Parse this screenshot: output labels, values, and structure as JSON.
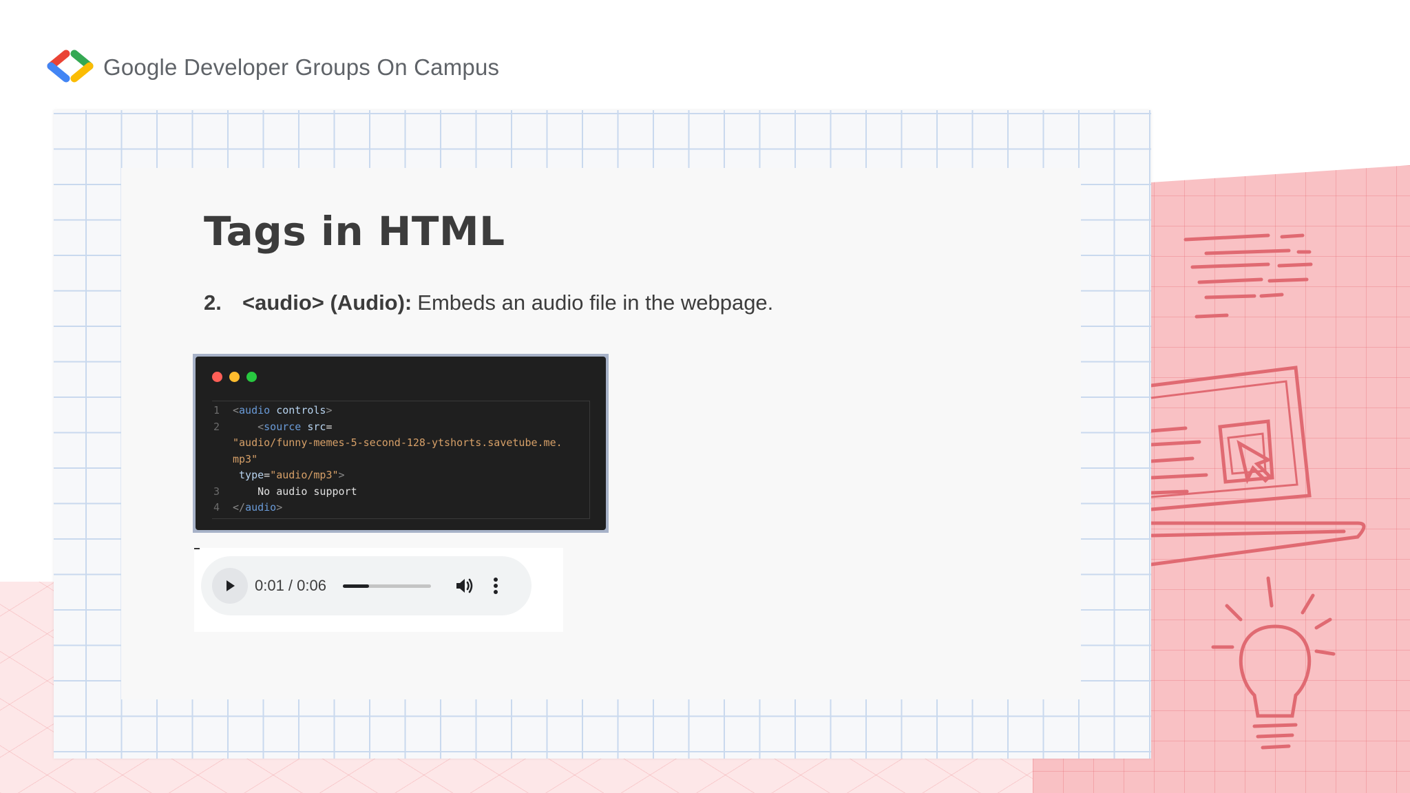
{
  "header": {
    "brand": "Google Developer Groups On Campus",
    "logo_icon": "gdg-chevrons-logo",
    "logo_colors": [
      "#ea4335",
      "#4285f4",
      "#34a853",
      "#fbbc04"
    ]
  },
  "slide": {
    "title": "Tags in HTML",
    "item": {
      "number": "2.",
      "term": "<audio> (Audio):",
      "description": "Embeds an audio file in the webpage."
    }
  },
  "code_window": {
    "dot_colors": [
      "#ff5f57",
      "#febc2e",
      "#28c840"
    ],
    "lines": [
      {
        "num": "1",
        "indent": "",
        "parts": [
          {
            "cls": "br",
            "text": "<"
          },
          {
            "cls": "tag",
            "text": "audio"
          },
          {
            "cls": "txt",
            "text": " "
          },
          {
            "cls": "attr",
            "text": "controls"
          },
          {
            "cls": "br",
            "text": ">"
          }
        ]
      },
      {
        "num": "2",
        "indent": "    ",
        "parts": [
          {
            "cls": "br",
            "text": "<"
          },
          {
            "cls": "tag",
            "text": "source"
          },
          {
            "cls": "txt",
            "text": " "
          },
          {
            "cls": "attr",
            "text": "src"
          },
          {
            "cls": "txt",
            "text": "="
          }
        ]
      },
      {
        "num": "",
        "indent": "",
        "parts": [
          {
            "cls": "str",
            "text": "\"audio/funny-memes-5-second-128-ytshorts.savetube.me."
          }
        ]
      },
      {
        "num": "",
        "indent": "",
        "parts": [
          {
            "cls": "str",
            "text": "mp3\""
          }
        ]
      },
      {
        "num": "",
        "indent": " ",
        "parts": [
          {
            "cls": "attr",
            "text": "type"
          },
          {
            "cls": "txt",
            "text": "="
          },
          {
            "cls": "str",
            "text": "\"audio/mp3\""
          },
          {
            "cls": "br",
            "text": ">"
          }
        ]
      },
      {
        "num": "3",
        "indent": "    ",
        "parts": [
          {
            "cls": "txt",
            "text": "No audio support"
          }
        ]
      },
      {
        "num": "4",
        "indent": "",
        "parts": [
          {
            "cls": "br",
            "text": "</"
          },
          {
            "cls": "tag",
            "text": "audio"
          },
          {
            "cls": "br",
            "text": ">"
          }
        ]
      }
    ]
  },
  "audio_player": {
    "time": "0:01 / 0:06",
    "progress_fraction": 0.3,
    "play_icon": "play-icon",
    "volume_icon": "volume-icon",
    "menu_icon": "more-vert-icon"
  }
}
